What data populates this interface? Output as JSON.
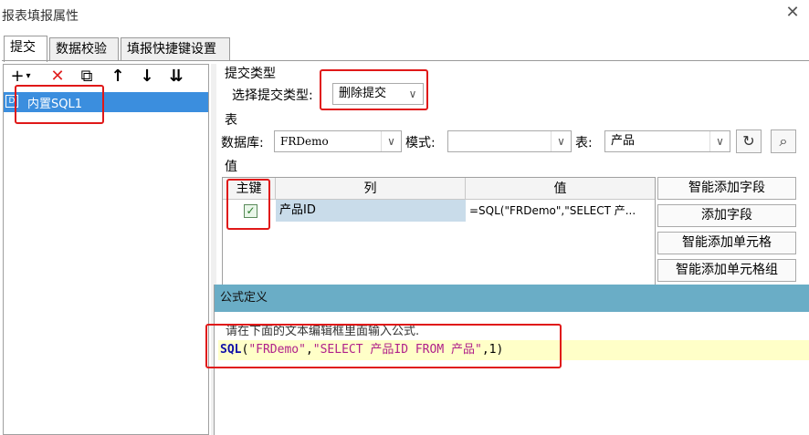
{
  "window": {
    "title": "报表填报属性",
    "close_glyph": "✕"
  },
  "tabs": [
    {
      "label": "提交",
      "active": true
    },
    {
      "label": "数据校验",
      "active": false
    },
    {
      "label": "填报快捷键设置",
      "active": false
    }
  ],
  "toolbar": {
    "add_glyph": "+",
    "add_dropdown_glyph": "▾",
    "delete_glyph": "✕",
    "copy_glyph": "⧉",
    "up_glyph": "↑",
    "down_glyph": "↓",
    "sort_glyph": "⇊"
  },
  "tree": {
    "items": [
      {
        "label": "内置SQL1",
        "icon": "sql-icon",
        "icon_glyph": "D"
      }
    ]
  },
  "submit_type": {
    "section_label": "提交类型",
    "select_label": "选择提交类型:",
    "selected": "删除提交"
  },
  "table_section": {
    "section_label": "表",
    "database_label": "数据库:",
    "database_value": "FRDemo",
    "schema_label": "模式:",
    "schema_value": "",
    "table_label": "表:",
    "table_value": "产品"
  },
  "values_section": {
    "section_label": "值",
    "columns": [
      "主键",
      "列",
      "值"
    ],
    "rows": [
      {
        "is_key": true,
        "column": "产品ID",
        "value": "=SQL(\"FRDemo\",\"SELECT 产..."
      }
    ],
    "buttons": {
      "smart_add_fields": "智能添加字段",
      "add_field": "添加字段",
      "smart_add_cells": "智能添加单元格",
      "smart_add_cell_group": "智能添加单元格组"
    }
  },
  "formula": {
    "title": "公式定义",
    "hint": "请在下面的文本编辑框里面输入公式.",
    "fn": "SQL",
    "open": "(",
    "arg1": "\"FRDemo\"",
    "comma1": ",",
    "arg2": "\"SELECT 产品ID FROM 产品\"",
    "comma2": ",",
    "arg3": "1",
    "close": ")"
  },
  "colors": {
    "accent": "#3b8ede",
    "highlight": "#e01818",
    "formula_header": "#6aadc6"
  }
}
